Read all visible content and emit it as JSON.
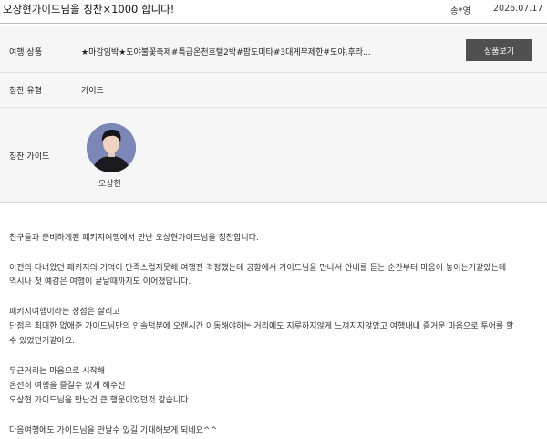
{
  "post": {
    "title": "오상현가이드님을 칭찬×1000 합니다!",
    "author": "송*영",
    "date": "2026.07.17"
  },
  "info": {
    "product_label": "여행 상품",
    "product_value": "★마감임박★도야불꽃축제#특급온천호텔2박#팜도미타#3대게무제한#도야,후라...",
    "view_button": "상품보기",
    "type_label": "칭찬 유형",
    "type_value": "가이드",
    "guide_label": "칭찬 가이드",
    "guide_name": "오상현"
  },
  "content": {
    "lines": [
      "친구들과 준비하게된 패키지여행에서 만난 오상현가이드님을 칭찬합니다.",
      "이전의 다녀왔던 패키지의 기억이 만족스럽지못해 여행전 걱정했는데 공항에서 가이드님을 만나서 안내를 듣는 순간부터 마음이 놓이는거같았는데",
      "역시나 첫 예감은 여행이 끝날때까지도 이어졌답니다.",
      "패키지여행이라는 장점은 살리고",
      "단점은 최대한 없애준 가이드님만의 인솔덕분에 오랜시간 이동해야하는 거리에도 지루하지않게 느껴지지않았고 여행내내 즐거운 마음으로 투어를 할",
      "수 있었던거같아요.",
      "두근거리는 마음으로 시작해",
      "온전히 여행을 즐길수 있게 해주신",
      "오상현 가이드님을 만난건 큰 행운이었던것 같습니다.",
      "다음여행에도 가이드님을 만날수 있길 기대해보게 되네요^^"
    ]
  }
}
